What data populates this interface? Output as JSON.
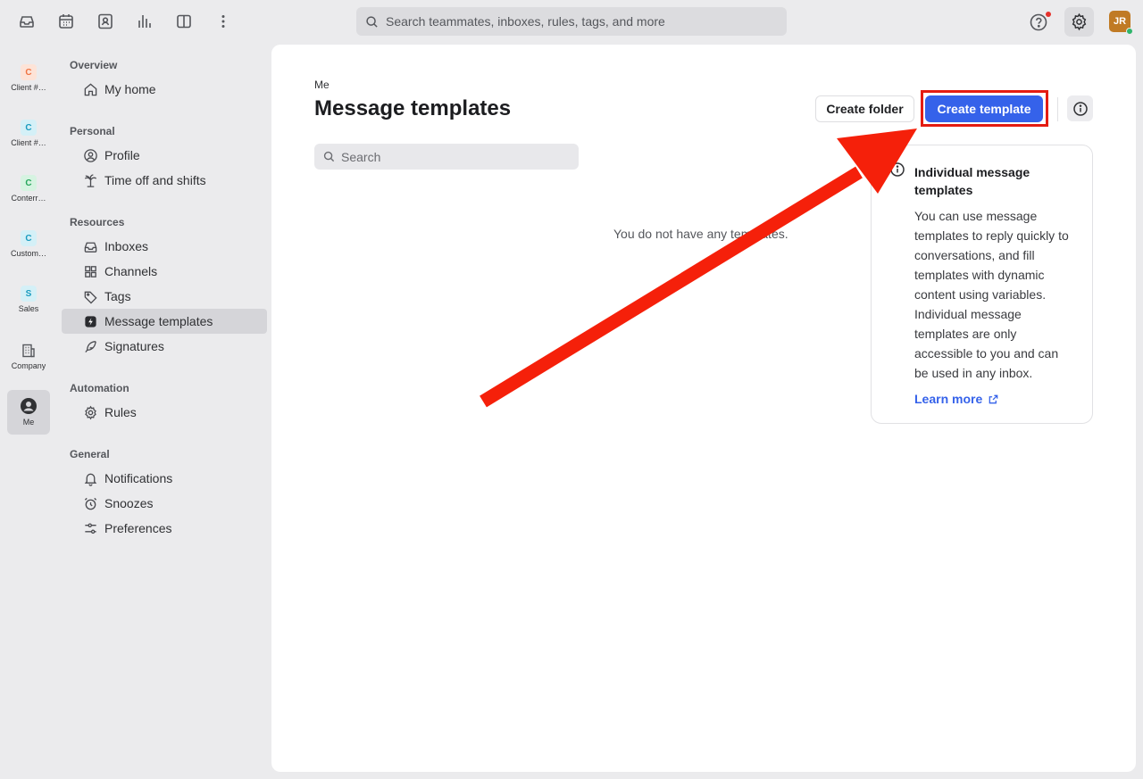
{
  "topbar": {
    "search_placeholder": "Search teammates, inboxes, rules, tags, and more",
    "avatar_initials": "JR",
    "icons": [
      "inbox-icon",
      "calendar-icon",
      "contacts-icon",
      "analytics-icon",
      "split-view-icon",
      "more-icon"
    ]
  },
  "rail": {
    "items": [
      {
        "letter": "C",
        "label": "Client #…",
        "color": "#f07342",
        "bg": "#fde3d7"
      },
      {
        "letter": "C",
        "label": "Client #…",
        "color": "#1a9bbf",
        "bg": "#d4f0f7"
      },
      {
        "letter": "C",
        "label": "Conterr…",
        "color": "#26a65b",
        "bg": "#d6f3e1"
      },
      {
        "letter": "C",
        "label": "Custom…",
        "color": "#1a9bbf",
        "bg": "#d4f0f7"
      },
      {
        "letter": "S",
        "label": "Sales",
        "color": "#1a9bbf",
        "bg": "#d4f0f7"
      }
    ],
    "company_label": "Company",
    "me_label": "Me"
  },
  "nav": {
    "overview_title": "Overview",
    "my_home": "My home",
    "personal_title": "Personal",
    "profile": "Profile",
    "time_off": "Time off and shifts",
    "resources_title": "Resources",
    "inboxes": "Inboxes",
    "channels": "Channels",
    "tags": "Tags",
    "message_templates": "Message templates",
    "signatures": "Signatures",
    "automation_title": "Automation",
    "rules": "Rules",
    "general_title": "General",
    "notifications": "Notifications",
    "snoozes": "Snoozes",
    "preferences": "Preferences"
  },
  "main": {
    "breadcrumb": "Me",
    "title": "Message templates",
    "create_folder": "Create folder",
    "create_template": "Create template",
    "search_placeholder": "Search",
    "empty_text": "You do not have any templates."
  },
  "info_card": {
    "title": "Individual message templates",
    "body": "You can use message templates to reply quickly to conversations, and fill templates with dynamic content using variables. Individual message templates are only accessible to you and can be used in any inbox.",
    "learn_more": "Learn more"
  },
  "colors": {
    "accent": "#3562ea",
    "annotation": "#f5200a"
  }
}
